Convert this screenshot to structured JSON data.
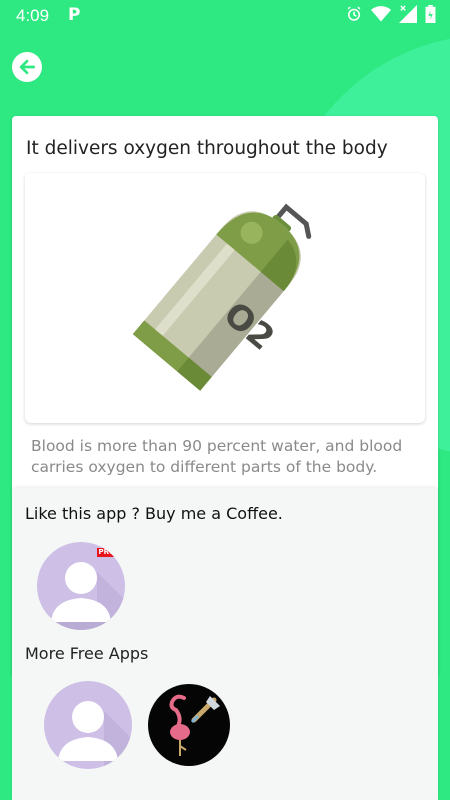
{
  "status": {
    "time": "4:09",
    "notification_letter": "P"
  },
  "colors": {
    "background": "#2ee882",
    "card": "#ffffff",
    "accent_red": "#e8141b",
    "avatar_bg": "#cdbfe6"
  },
  "card": {
    "title": "It delivers oxygen throughout the body",
    "image_text": "O2",
    "description": "Blood is more than 90 percent water, and blood carries oxygen to different parts of the body."
  },
  "sheet": {
    "title": "Like this app ? Buy me a Coffee.",
    "pro_badge": "PRO",
    "more_apps_label": "More Free Apps"
  },
  "icons": {
    "back": "back-arrow-icon",
    "alarm": "alarm-icon",
    "wifi": "wifi-icon",
    "signal": "signal-icon",
    "battery": "battery-icon"
  }
}
